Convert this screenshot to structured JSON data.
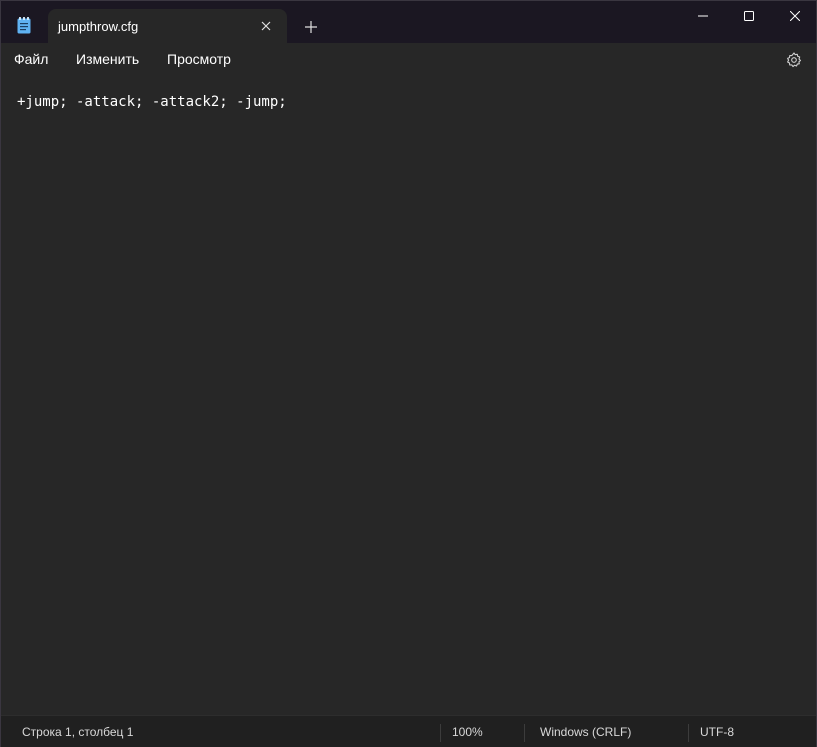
{
  "tab": {
    "title": "jumpthrow.cfg"
  },
  "icons": {
    "app": "notepad-icon",
    "tab_close": "close-icon",
    "new_tab": "plus-icon",
    "minimize": "minimize-icon",
    "maximize": "maximize-icon",
    "close": "close-icon",
    "settings": "gear-icon"
  },
  "menu": {
    "file": "Файл",
    "edit": "Изменить",
    "view": "Просмотр"
  },
  "editor": {
    "content": "+jump; -attack; -attack2; -jump;"
  },
  "status": {
    "position": "Строка 1, столбец 1",
    "zoom": "100%",
    "line_ending": "Windows (CRLF)",
    "encoding": "UTF-8"
  },
  "colors": {
    "titlebar": "#1b1722",
    "background": "#272727",
    "statusbar": "#202020",
    "accent": "#5fb2f2"
  }
}
